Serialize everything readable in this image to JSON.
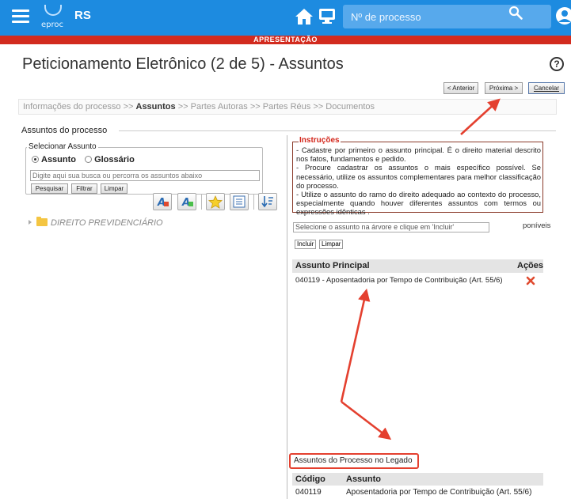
{
  "header": {
    "region": "RS",
    "logo_text": "eproc",
    "search_placeholder": "Nº de processo"
  },
  "environment": {
    "label": "APRESENTAÇÃO"
  },
  "page": {
    "title": "Peticionamento Eletrônico (2 de 5) - Assuntos",
    "help": "?"
  },
  "nav_buttons": {
    "prev": "< Anterior",
    "next": "Próxima >",
    "cancel": "Cancelar"
  },
  "breadcrumb": {
    "steps": [
      "Informações do processo",
      "Assuntos",
      "Partes Autoras",
      "Partes Réus",
      "Documentos"
    ],
    "separator": ">>",
    "active_index": 1
  },
  "section_title": "Assuntos do processo",
  "selecionar": {
    "legend": "Selecionar Assunto",
    "radio_options": [
      {
        "label": "Assunto",
        "checked": true
      },
      {
        "label": "Glossário",
        "checked": false
      }
    ],
    "search_placeholder": "Digite aqui sua busca ou percorra os assuntos abaixo",
    "buttons": {
      "pesquisar": "Pesquisar",
      "filtrar": "Filtrar",
      "limpar": "Limpar"
    }
  },
  "toolbar_icons": [
    "highlight-a-icon",
    "highlight-a-alt-icon",
    "favorite-star-icon",
    "list-view-icon",
    "sort-icon"
  ],
  "tree": {
    "root_label": "DIREITO PREVIDENCIÁRIO"
  },
  "instrucoes": {
    "title": "Instruções",
    "items": [
      "- Cadastre por primeiro o assunto principal. É o direito material descrito nos fatos, fundamentos e pedido.",
      "- Procure cadastrar os assuntos o mais específico possível. Se necessário, utilize os assuntos complementares para melhor classificação do processo.",
      "- Utilize o assunto do ramo do direito adequado ao contexto do processo, especialmente quando houver diferentes assuntos com termos ou expressões idênticas ."
    ]
  },
  "incluir": {
    "placeholder": "Selecione o assunto na árvore e clique em 'Incluir'",
    "disponiveis": "poníveis",
    "incluir_label": "Incluir",
    "limpar_label": "Limpar"
  },
  "principal_table": {
    "headers": {
      "assunto": "Assunto Principal",
      "acoes": "Ações"
    },
    "row": {
      "assunto": "040119 - Aposentadoria por Tempo de Contribuição (Art. 55/6)"
    }
  },
  "legado": {
    "title": "Assuntos do Processo no Legado",
    "headers": {
      "codigo": "Código",
      "assunto": "Assunto"
    },
    "row": {
      "codigo": "040119",
      "assunto": "Aposentadoria por Tempo de Contribuição (Art. 55/6)"
    }
  },
  "colors": {
    "topbar": "#1d8be0",
    "env_banner": "#d22b1f",
    "annotation_arrow": "#e4402f",
    "instructions_title": "#d3261b",
    "table_header": "#e4e4e4"
  }
}
